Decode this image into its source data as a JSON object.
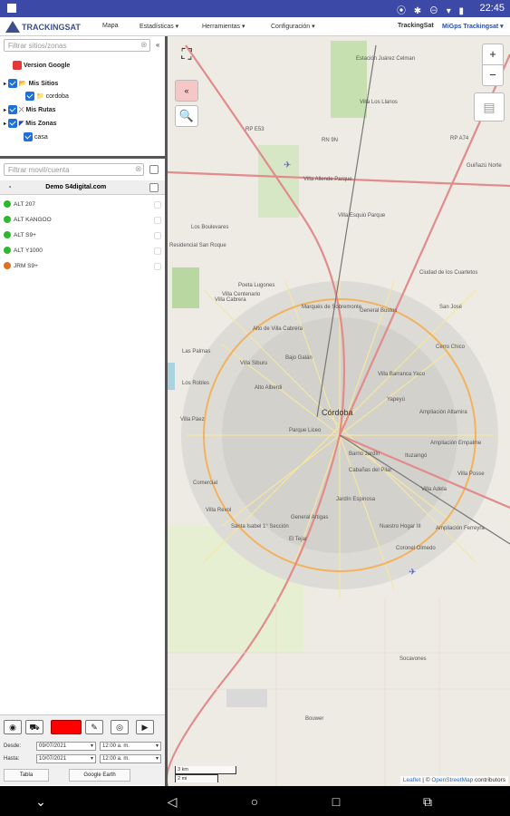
{
  "status_bar": {
    "time": "22:45",
    "icons": [
      "location-icon",
      "bluetooth-icon",
      "dnd-icon",
      "wifi-icon",
      "battery-icon"
    ]
  },
  "header": {
    "logo_text": "TRACKINGSAT",
    "menu": [
      "Mapa",
      "Estadísticas ▾",
      "Herramientas ▾",
      "Configuración ▾"
    ],
    "brand": "TrackingSat",
    "user": "MiGps Trackingsat ▾"
  },
  "sites": {
    "filter_placeholder": "Filtrar sitios/zonas",
    "root": "Version Google",
    "items": [
      {
        "label": "Mis Sitios",
        "children": [
          "cordoba"
        ]
      },
      {
        "label": "Mis Rutas",
        "children": []
      },
      {
        "label": "Mis Zonas",
        "children": [
          "casa"
        ]
      }
    ]
  },
  "vehicles": {
    "filter_placeholder": "Filtrar movil/cuenta",
    "group": "Demo S4digital.com",
    "list": [
      {
        "name": "ALT 207",
        "color": "#2db82d"
      },
      {
        "name": "ALT KANGOO",
        "color": "#2db82d"
      },
      {
        "name": "ALT S9+",
        "color": "#2db82d"
      },
      {
        "name": "ALT Y1000",
        "color": "#2db82d"
      },
      {
        "name": "JRM S9+",
        "color": "#e0701e"
      }
    ]
  },
  "tools": {
    "desde_label": "Desde:",
    "desde_date": "09/07/2021",
    "desde_time": "12:00 a. m.",
    "hasta_label": "Hasta:",
    "hasta_date": "10/07/2021",
    "hasta_time": "12:00 a. m.",
    "color_swatch": "#ff0000",
    "tabla_label": "Tabla",
    "google_earth_label": "Google Earth"
  },
  "map": {
    "zoom_in": "+",
    "zoom_out": "−",
    "city_label": "Córdoba",
    "labels": [
      "Estación Juárez Celman",
      "Villa Los Llanos",
      "RP E53",
      "RN 9N",
      "RP A74",
      "Villa Allende Parque",
      "Villa Esquiú Parque",
      "Los Boulevares",
      "Residencial San Roque",
      "Marqués de Sobremonte",
      "Alto de Villa Cabrera",
      "Villa Cabrera",
      "Bajo Galán",
      "Yapeyú",
      "Villa Barranca Yaco",
      "General Bustos",
      "Ciudad de los Cuartetos",
      "Villa Centenario",
      "Alto Alberdi",
      "Villa Siburu",
      "Ampliación Altamira",
      "Barrio Jardín",
      "Ampliación Empalme",
      "Comercial",
      "Villa Posse",
      "Nuestro Hogar III",
      "Coronel Olmedo",
      "Cabañas del Pilar",
      "Jardín Espinosa",
      "General Artigas",
      "Villa Revol",
      "Santa Isabel 1° Sección",
      "El Tejar",
      "Ampliación Ferreyra",
      "Socavones",
      "Bouwer",
      "Villa Páez",
      "Las Palmas",
      "Los Robles",
      "Villa Adela",
      "Ituzaingó",
      "San José",
      "Guiñazú Norte",
      "Poeta Lugones",
      "Cerro Chico",
      "Parque Liceo"
    ],
    "scale_km": "3 km",
    "scale_mi": "2 mi",
    "attribution_leaflet": "Leaflet",
    "attribution_sep": " | © ",
    "attribution_osm": "OpenStreetMap",
    "attribution_end": " contributors"
  }
}
